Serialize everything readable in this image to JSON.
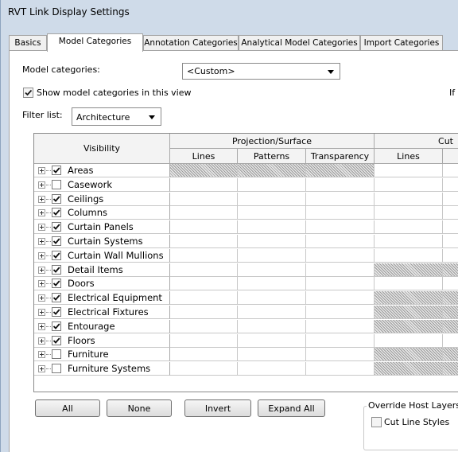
{
  "window": {
    "title": "RVT Link Display Settings"
  },
  "tabs": [
    {
      "label": "Basics",
      "active": false
    },
    {
      "label": "Model Categories",
      "active": true
    },
    {
      "label": "Annotation Categories",
      "active": false
    },
    {
      "label": "Analytical Model Categories",
      "active": false
    },
    {
      "label": "Import Categories",
      "active": false
    }
  ],
  "model_categories": {
    "label": "Model categories:",
    "value": "<Custom>"
  },
  "show_checkbox": {
    "label": "Show model categories in this view",
    "checked": true
  },
  "right_partial_text": "If",
  "filter": {
    "label": "Filter list:",
    "value": "Architecture"
  },
  "table": {
    "visibility_header": "Visibility",
    "group_headers": {
      "projection": "Projection/Surface",
      "cut": "Cut"
    },
    "sub_headers": {
      "lines": "Lines",
      "patterns": "Patterns",
      "transparency": "Transparency",
      "cut_lines": "Lines"
    },
    "rows": [
      {
        "label": "Areas",
        "checked": true,
        "proj_hatched": true,
        "cut_hatched": false
      },
      {
        "label": "Casework",
        "checked": false,
        "proj_hatched": false,
        "cut_hatched": false
      },
      {
        "label": "Ceilings",
        "checked": true,
        "proj_hatched": false,
        "cut_hatched": false
      },
      {
        "label": "Columns",
        "checked": true,
        "proj_hatched": false,
        "cut_hatched": false
      },
      {
        "label": "Curtain Panels",
        "checked": true,
        "proj_hatched": false,
        "cut_hatched": false
      },
      {
        "label": "Curtain Systems",
        "checked": true,
        "proj_hatched": false,
        "cut_hatched": false
      },
      {
        "label": "Curtain Wall Mullions",
        "checked": true,
        "proj_hatched": false,
        "cut_hatched": false
      },
      {
        "label": "Detail Items",
        "checked": true,
        "proj_hatched": false,
        "cut_hatched": true
      },
      {
        "label": "Doors",
        "checked": true,
        "proj_hatched": false,
        "cut_hatched": false
      },
      {
        "label": "Electrical Equipment",
        "checked": true,
        "proj_hatched": false,
        "cut_hatched": true
      },
      {
        "label": "Electrical Fixtures",
        "checked": true,
        "proj_hatched": false,
        "cut_hatched": true
      },
      {
        "label": "Entourage",
        "checked": true,
        "proj_hatched": false,
        "cut_hatched": true
      },
      {
        "label": "Floors",
        "checked": true,
        "proj_hatched": false,
        "cut_hatched": false
      },
      {
        "label": "Furniture",
        "checked": false,
        "proj_hatched": false,
        "cut_hatched": true
      },
      {
        "label": "Furniture Systems",
        "checked": false,
        "proj_hatched": false,
        "cut_hatched": true
      }
    ]
  },
  "buttons": {
    "all": "All",
    "none": "None",
    "invert": "Invert",
    "expand_all": "Expand All"
  },
  "override_group": {
    "title": "Override Host Layers",
    "cut_line_styles": "Cut Line Styles",
    "checked": false
  }
}
